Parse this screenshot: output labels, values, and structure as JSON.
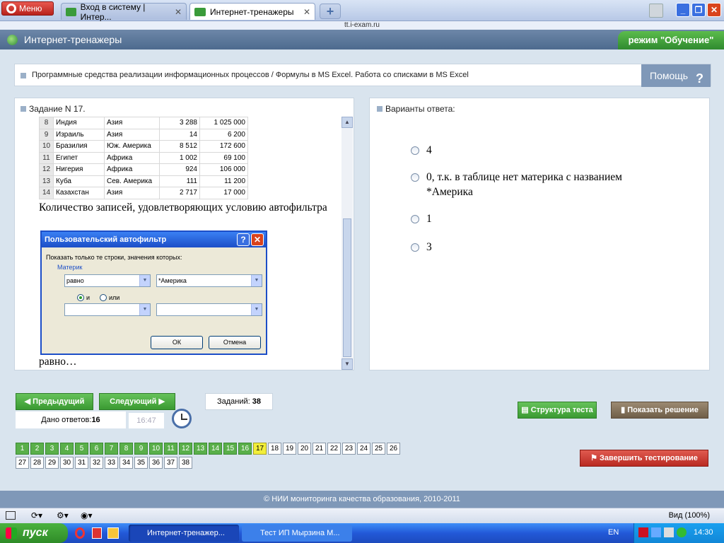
{
  "browser": {
    "menu_label": "Меню",
    "tabs": [
      {
        "label": "Вход в систему | Интер..."
      },
      {
        "label": "Интернет-тренажеры"
      }
    ],
    "address": "tt.i-exam.ru",
    "status": {
      "zoom": "Вид (100%)"
    }
  },
  "app": {
    "title": "Интернет-тренажеры",
    "mode": "режим \"Обучение\"",
    "topic": "Программные средства реализации информационных процессов / Формулы в MS Excel. Работа со списками в MS Excel",
    "help_label": "Помощь",
    "help_icon": "?"
  },
  "task": {
    "title": "Задание N 17.",
    "table_rows": [
      {
        "num": "8",
        "country": "Индия",
        "continent": "Азия",
        "area": "3 288",
        "population": "1 025 000"
      },
      {
        "num": "9",
        "country": "Израиль",
        "continent": "Азия",
        "area": "14",
        "population": "6 200"
      },
      {
        "num": "10",
        "country": "Бразилия",
        "continent": "Юж. Америка",
        "area": "8 512",
        "population": "172 600"
      },
      {
        "num": "11",
        "country": "Египет",
        "continent": "Африка",
        "area": "1 002",
        "population": "69 100"
      },
      {
        "num": "12",
        "country": "Нигерия",
        "continent": "Африка",
        "area": "924",
        "population": "106 000"
      },
      {
        "num": "13",
        "country": "Куба",
        "continent": "Сев. Америка",
        "area": "111",
        "population": "11 200"
      },
      {
        "num": "14",
        "country": "Казахстан",
        "continent": "Азия",
        "area": "2 717",
        "population": "17 000"
      }
    ],
    "question": "Количество записей, удовлетворяющих условию автофильтра",
    "question_tail": "равно…",
    "dialog": {
      "title": "Пользовательский автофильтр",
      "show_label": "Показать только те строки, значения которых:",
      "field": "Материк",
      "op1": "равно",
      "val1": "*Америка",
      "radio_and": "и",
      "radio_or": "или",
      "ok": "ОК",
      "cancel": "Отмена"
    }
  },
  "answers": {
    "title": "Варианты ответа:",
    "options": [
      {
        "text": "4"
      },
      {
        "text": "0, т.к. в таблице нет материка с названием *Америка"
      },
      {
        "text": "1"
      },
      {
        "text": "3"
      }
    ]
  },
  "nav": {
    "prev": "Предыдущий",
    "next": "Следующий",
    "tasks_label": "Заданий:",
    "tasks_count": "38",
    "given_label": "Дано ответов:",
    "given_count": "16",
    "timer": "16:47",
    "structure": "Структура теста",
    "show_solution": "Показать решение",
    "finish": "Завершить тестирование"
  },
  "grid": {
    "done": [
      "1",
      "2",
      "3",
      "4",
      "5",
      "6",
      "7",
      "8",
      "9",
      "10",
      "11",
      "12",
      "13",
      "14",
      "15",
      "16"
    ],
    "current": "17",
    "todo": [
      "18",
      "19",
      "20",
      "21",
      "22",
      "23",
      "24",
      "25",
      "26",
      "27",
      "28",
      "29",
      "30",
      "31",
      "32",
      "33",
      "34",
      "35",
      "36",
      "37",
      "38"
    ]
  },
  "footer": "© НИИ мониторинга качества образования, 2010-2011",
  "taskbar": {
    "start": "пуск",
    "items": [
      {
        "label": "Интернет-тренажер..."
      },
      {
        "label": "Тест ИП Мырзина М..."
      }
    ],
    "lang": "EN",
    "time": "14:30"
  },
  "colors": {
    "accent_green": "#3a9a32",
    "header_blue": "#5a7599",
    "current_task": "#f2ee3a",
    "finish_red": "#d9302c"
  }
}
